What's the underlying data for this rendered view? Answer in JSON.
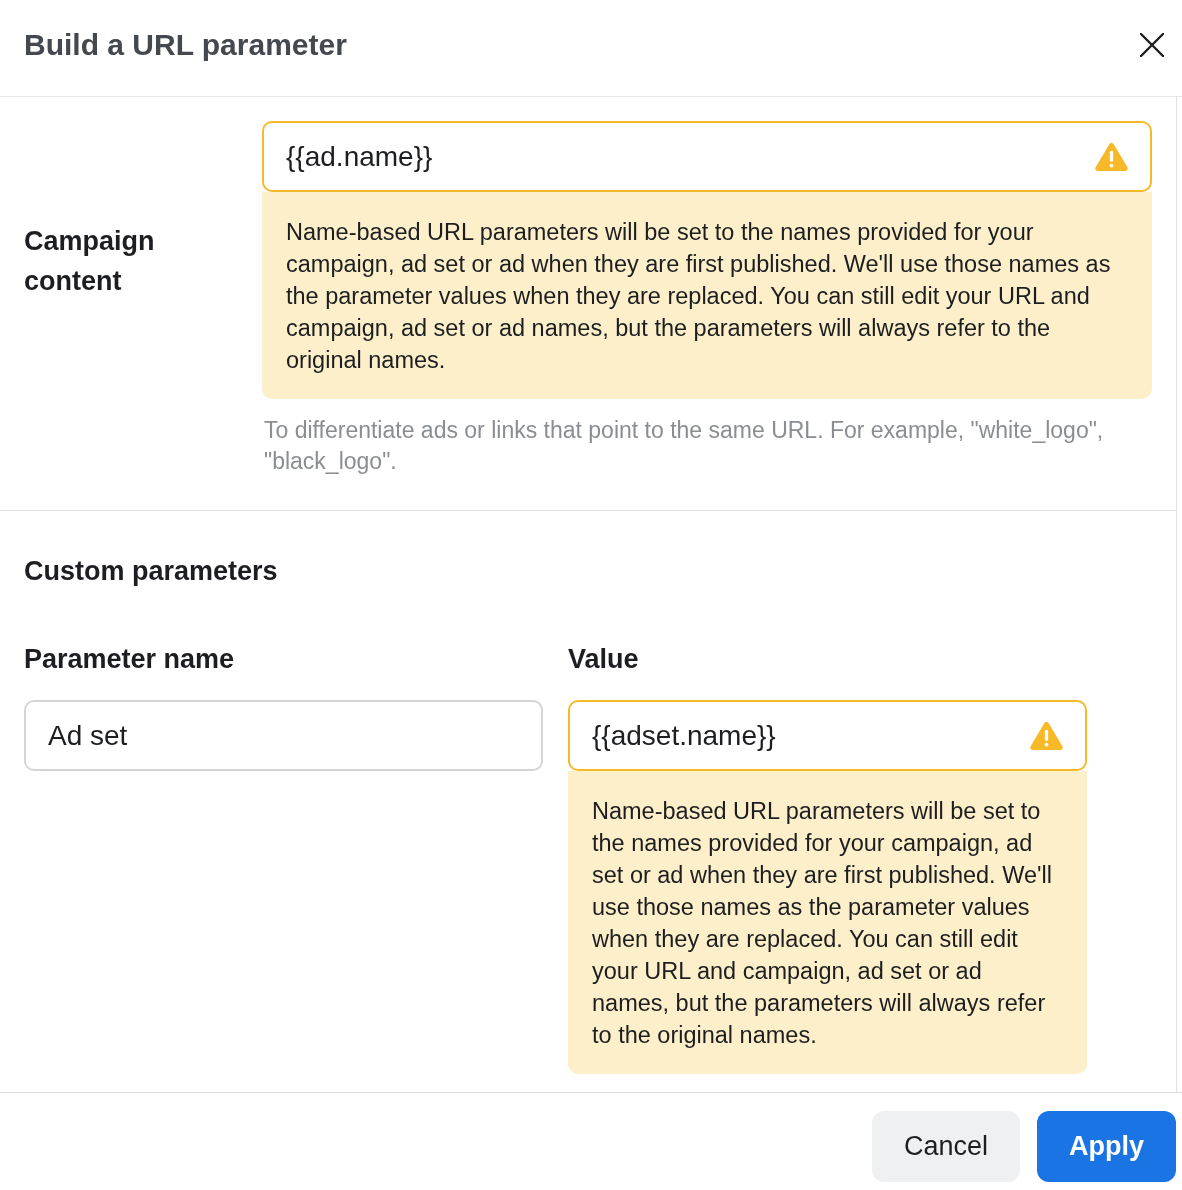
{
  "dialog": {
    "title": "Build a URL parameter"
  },
  "campaign_content": {
    "label": "Campaign content",
    "field": {
      "value": "{{ad.name}}",
      "warning": true,
      "warning_message": "Name-based URL parameters will be set to the names provided for your campaign, ad set or ad when they are first published. We'll use those names as the parameter values when they are replaced. You can still edit your URL and campaign, ad set or ad names, but the parameters will always refer to the original names."
    },
    "help": "To differentiate ads or links that point to the same URL. For example, \"white_logo\", \"black_logo\"."
  },
  "custom_parameters": {
    "heading": "Custom parameters",
    "columns": [
      "Parameter name",
      "Value"
    ],
    "rows": [
      {
        "name": {
          "value": "Ad set",
          "warning": false
        },
        "value": {
          "value": "{{adset.name}}",
          "warning": true,
          "warning_message": "Name-based URL parameters will be set to the names provided for your campaign, ad set or ad when they are first published. We'll use those names as the parameter values when they are replaced. You can still edit your URL and campaign, ad set or ad names, but the parameters will always refer to the original names."
        }
      }
    ]
  },
  "footer": {
    "buttons": [
      {
        "label": "Cancel",
        "kind": "secondary"
      },
      {
        "label": "Apply",
        "kind": "primary"
      }
    ]
  }
}
